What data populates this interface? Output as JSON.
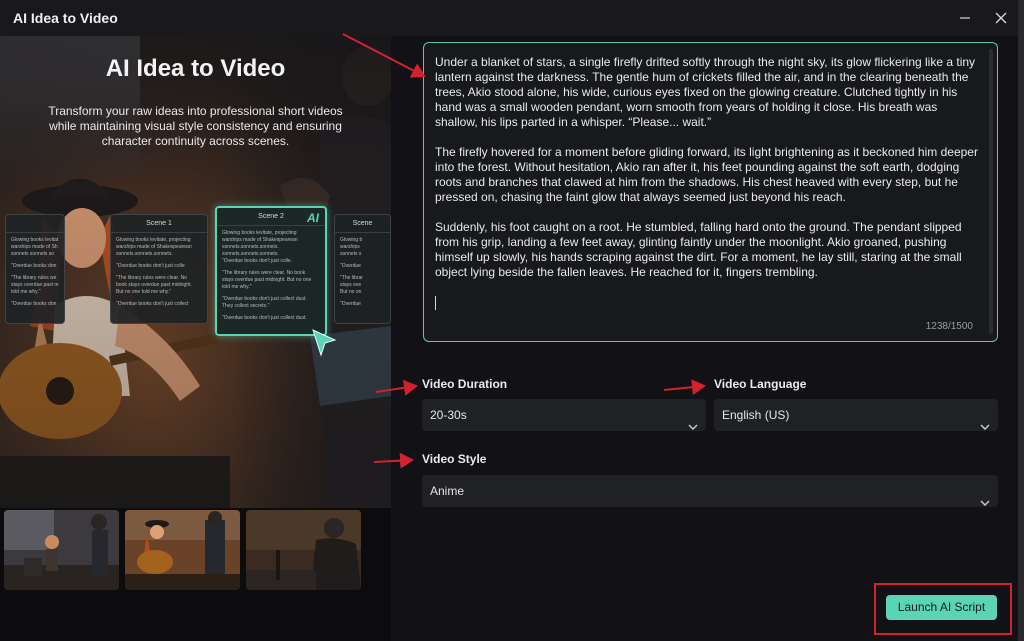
{
  "window": {
    "title": "AI Idea to Video"
  },
  "hero": {
    "title": "AI Idea to Video",
    "subtitle": "Transform your raw ideas into professional short videos while maintaining visual style consistency and ensuring character continuity across scenes."
  },
  "scene_cards": [
    {
      "title": "",
      "lines": [
        "Glowing books levitat",
        "warships made of Sh",
        "sonnets sonnets so",
        "",
        "\"Overdue books don",
        "",
        "\"The library rules we",
        "stays overdue past m",
        "told me why.\"",
        "",
        "\"Overdue books don"
      ]
    },
    {
      "title": "Scene 1",
      "lines": [
        "Glowing books levitate, projecting",
        "warships made of Shakespearean",
        "sonnets.sonnets.sonnets.",
        "",
        "\"Overdue books don't just colle",
        "",
        "\"The library rules were clear. No",
        "book stays overdue past midnight.",
        "But no one told me why.\"",
        "",
        "\"Overdue books don't just collect"
      ]
    },
    {
      "title": "Scene 2",
      "badge": "AI",
      "lines": [
        "Glowing books levitate, projecting",
        "warships made of Shakespearean",
        "sonnets.sonnets.sonnets.",
        "sonnets.sonnets.sonnets.",
        "\"Overdue books don't just colle.",
        "",
        "\"The library rules were clear. No book",
        "stays overdue past midnight. But no one",
        "told me why.\"",
        "",
        "\"Overdue books don't just collect dust.",
        "They collect secrets.\"",
        "",
        "\"Overdue books don't just collect dust."
      ]
    },
    {
      "title": "Scene",
      "lines": [
        "Glowing b",
        "warships",
        "sonnets s",
        "",
        "\"Overdue",
        "",
        "\"The librar",
        "stays ove",
        "But no on",
        "",
        "\"Overdue"
      ]
    }
  ],
  "prompt": {
    "text": "Under a blanket of stars, a single firefly drifted softly through the night sky, its glow flickering like a tiny lantern against the darkness. The gentle hum of crickets filled the air, and in the clearing beneath the trees, Akio stood alone, his wide, curious eyes fixed on the glowing creature. Clutched tightly in his hand was a small wooden pendant, worn smooth from years of holding it close. His breath was shallow, his lips parted in a whisper. “Please... wait.”\n\nThe firefly hovered for a moment before gliding forward, its light brightening as it beckoned him deeper into the forest. Without hesitation, Akio ran after it, his feet pounding against the soft earth, dodging roots and branches that clawed at him from the shadows. His chest heaved with every step, but he pressed on, chasing the faint glow that always seemed just beyond his reach.\n\nSuddenly, his foot caught on a root. He stumbled, falling hard onto the ground. The pendant slipped from his grip, landing a few feet away, glinting faintly under the moonlight. Akio groaned, pushing himself up slowly, his hands scraping against the dirt. For a moment, he lay still, staring at the small object lying beside the fallen leaves. He reached for it, fingers trembling.\n\n",
    "counter": "1238/1500"
  },
  "fields": {
    "duration": {
      "label": "Video Duration",
      "value": "20-30s"
    },
    "language": {
      "label": "Video Language",
      "value": "English (US)"
    },
    "style": {
      "label": "Video Style",
      "value": "Anime"
    }
  },
  "actions": {
    "launch_label": "Launch AI Script"
  },
  "colors": {
    "accent": "#5bd4b6",
    "annotation_red": "#d3222f",
    "panel_bg": "#121216"
  },
  "icons": [
    "minimize-icon",
    "close-icon",
    "chevron-down-icon"
  ]
}
